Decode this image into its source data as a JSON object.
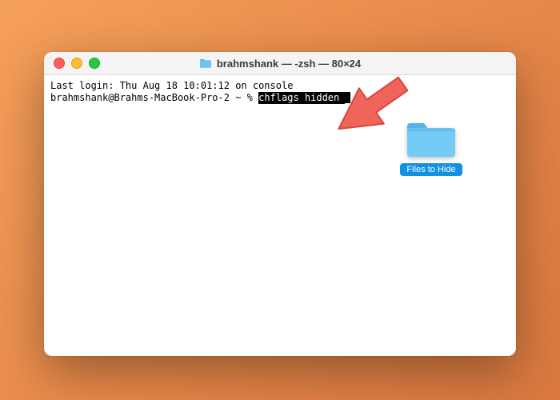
{
  "window": {
    "title": "brahmshank — -zsh — 80×24"
  },
  "terminal": {
    "last_login": "Last login: Thu Aug 18 10:01:12 on console",
    "prompt": "brahmshank@Brahms-MacBook-Pro-2 ~ % ",
    "command": "chflags hidden "
  },
  "folder": {
    "label": "Files to Hide"
  },
  "colors": {
    "folder_fill": "#6ac5f0",
    "folder_tab": "#4fb5e8",
    "label_bg": "#1092e3",
    "arrow_fill": "#f0655a",
    "arrow_stroke": "#d8463c"
  }
}
